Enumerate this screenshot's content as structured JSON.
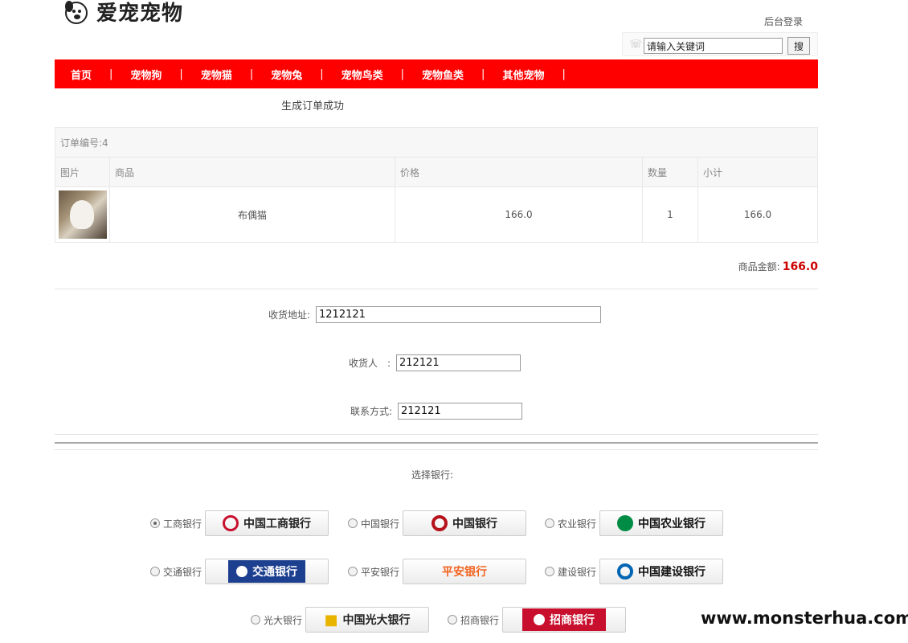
{
  "brand": {
    "name": "爱宠宠物"
  },
  "header": {
    "top_links_partial": "",
    "admin_login": "后台登录"
  },
  "search": {
    "value": "请输入关键词",
    "button": "搜"
  },
  "nav": {
    "items": [
      "首页",
      "宠物狗",
      "宠物猫",
      "宠物兔",
      "宠物鸟类",
      "宠物鱼类",
      "其他宠物"
    ],
    "separator": "|"
  },
  "order": {
    "success_message": "生成订单成功",
    "number_label": "订单编号:4",
    "columns": [
      "图片",
      "商品",
      "价格",
      "数量",
      "小计"
    ],
    "items": [
      {
        "name": "布偶猫",
        "price": "166.0",
        "quantity": "1",
        "subtotal": "166.0"
      }
    ],
    "total_label": "商品金额:",
    "total_value": "166.0"
  },
  "form": {
    "address_label": "收货地址:",
    "address_value": "1212121",
    "receiver_label": "收货人　:",
    "receiver_value": "212121",
    "contact_label": "联系方式:",
    "contact_value": "212121"
  },
  "banks": {
    "title": "选择银行:",
    "items": [
      {
        "label": "工商银行",
        "logo_text": "中国工商银行",
        "color": "#c8102e",
        "checked": true
      },
      {
        "label": "中国银行",
        "logo_text": "中国银行",
        "color": "#b5121b",
        "checked": false
      },
      {
        "label": "农业银行",
        "logo_text": "中国农业银行",
        "color": "#008c45",
        "checked": false
      },
      {
        "label": "交通银行",
        "logo_text": "交通银行",
        "color": "#1d3f8f",
        "checked": false
      },
      {
        "label": "平安银行",
        "logo_text": "平安银行",
        "color": "#f26522",
        "checked": false
      },
      {
        "label": "建设银行",
        "logo_text": "中国建设银行",
        "color": "#0066b3",
        "checked": false
      },
      {
        "label": "光大银行",
        "logo_text": "中国光大银行",
        "color": "#6a1b77",
        "checked": false
      },
      {
        "label": "招商银行",
        "logo_text": "招商银行",
        "color": "#c8102e",
        "checked": false
      }
    ]
  },
  "watermark": "www.monsterhua.com"
}
